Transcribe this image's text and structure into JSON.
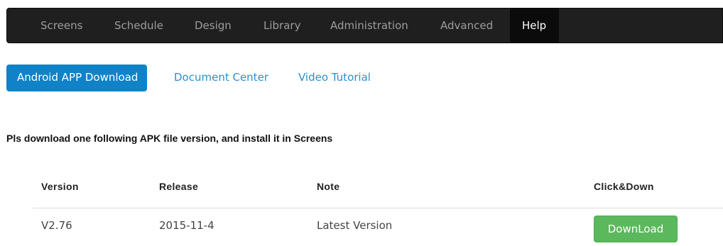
{
  "navbar": {
    "items": [
      {
        "label": "Screens",
        "active": false
      },
      {
        "label": "Schedule",
        "active": false
      },
      {
        "label": "Design",
        "active": false
      },
      {
        "label": "Library",
        "active": false
      },
      {
        "label": "Administration",
        "active": false
      },
      {
        "label": "Advanced",
        "active": false
      },
      {
        "label": "Help",
        "active": true
      }
    ]
  },
  "tabs": [
    {
      "label": "Android APP Download",
      "active": true
    },
    {
      "label": "Document Center",
      "active": false
    },
    {
      "label": "Video Tutorial",
      "active": false
    }
  ],
  "instruction": "Pls download one following APK file version, and install it in Screens",
  "table": {
    "headers": [
      "Version",
      "Release",
      "Note",
      "Click&Down"
    ],
    "rows": [
      {
        "version": "V2.76",
        "release": "2015-11-4",
        "note": "Latest Version",
        "action_label": "DownLoad"
      }
    ]
  },
  "colors": {
    "navbar_bg": "#1f1f1f",
    "active_tab": "#0f82c8",
    "link": "#2a8fd0",
    "download_button": "#5cb85c"
  }
}
